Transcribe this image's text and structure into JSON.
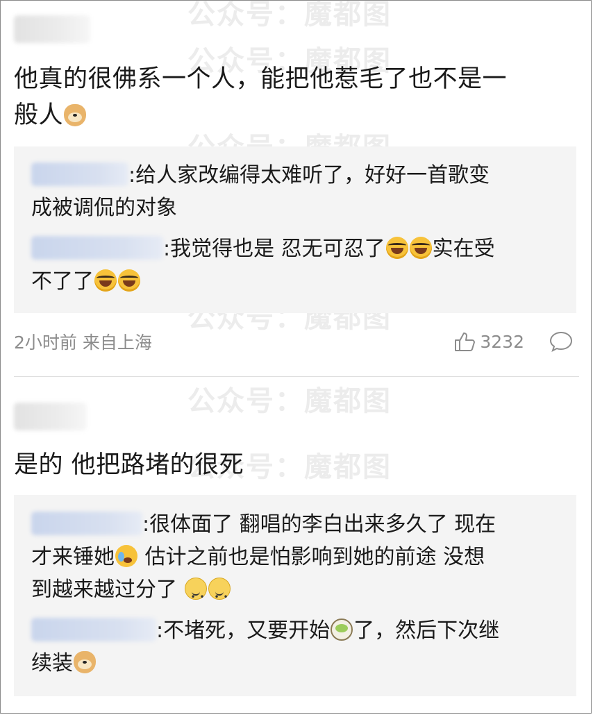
{
  "watermark": "公众号：魔都图",
  "posts": [
    {
      "text_line1": "他真的很佛系一个人，能把他惹毛了也不是一",
      "text_line2": "般人",
      "replies": [
        {
          "line1": ":给人家改编得太难听了，好好一首歌变",
          "line2": "成被调侃的对象"
        },
        {
          "line1a": ":我觉得也是 忍无可忍了",
          "line1b": "实在受",
          "line2": "不了了"
        }
      ],
      "meta": {
        "time_location": "2小时前 来自上海",
        "likes": "3232"
      }
    },
    {
      "text_line1": "是的 他把路堵的很死",
      "replies": [
        {
          "line1": ":很体面了 翻唱的李白出来多久了 现在",
          "line2a": "才来锤她",
          "line2b": " 估计之前也是怕影响到她的前途 没想",
          "line3": "到越来越过分了 "
        },
        {
          "line1a": ":不堵死，又要开始",
          "line1b": "了，然后下次继",
          "line2": "续装"
        }
      ]
    }
  ],
  "icons": {
    "like": "thumbs-up-icon",
    "comment": "comment-bubble-icon"
  }
}
